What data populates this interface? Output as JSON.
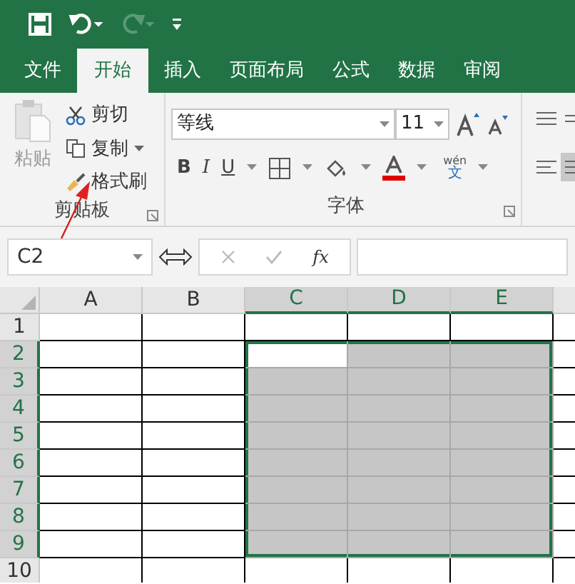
{
  "quick_access": {
    "undo_enabled": true,
    "redo_enabled": false
  },
  "tabs": [
    {
      "label": "文件",
      "selected": false
    },
    {
      "label": "开始",
      "selected": true
    },
    {
      "label": "插入",
      "selected": false
    },
    {
      "label": "页面布局",
      "selected": false
    },
    {
      "label": "公式",
      "selected": false
    },
    {
      "label": "数据",
      "selected": false
    },
    {
      "label": "审阅",
      "selected": false
    }
  ],
  "clipboard": {
    "paste": "粘贴",
    "cut": "剪切",
    "copy": "复制",
    "format_painter": "格式刷",
    "group_label": "剪贴板"
  },
  "font": {
    "name": "等线",
    "size": "11",
    "phonetic_top": "wén",
    "phonetic_bottom": "文",
    "bold": "B",
    "italic": "I",
    "underline": "U",
    "group_label": "字体"
  },
  "formula_bar": {
    "name_box": "C2",
    "fx": "fx"
  },
  "columns": [
    {
      "label": "A",
      "selected": false,
      "active": false
    },
    {
      "label": "B",
      "selected": false,
      "active": false
    },
    {
      "label": "C",
      "selected": true,
      "active": true
    },
    {
      "label": "D",
      "selected": true,
      "active": false
    },
    {
      "label": "E",
      "selected": true,
      "active": false
    }
  ],
  "rows": [
    {
      "label": "1",
      "selected": false,
      "active": false
    },
    {
      "label": "2",
      "selected": true,
      "active": true
    },
    {
      "label": "3",
      "selected": true,
      "active": false
    },
    {
      "label": "4",
      "selected": true,
      "active": false
    },
    {
      "label": "5",
      "selected": true,
      "active": false
    },
    {
      "label": "6",
      "selected": true,
      "active": false
    },
    {
      "label": "7",
      "selected": true,
      "active": false
    },
    {
      "label": "8",
      "selected": true,
      "active": false
    },
    {
      "label": "9",
      "selected": true,
      "active": false
    },
    {
      "label": "10",
      "selected": false,
      "active": false
    }
  ]
}
